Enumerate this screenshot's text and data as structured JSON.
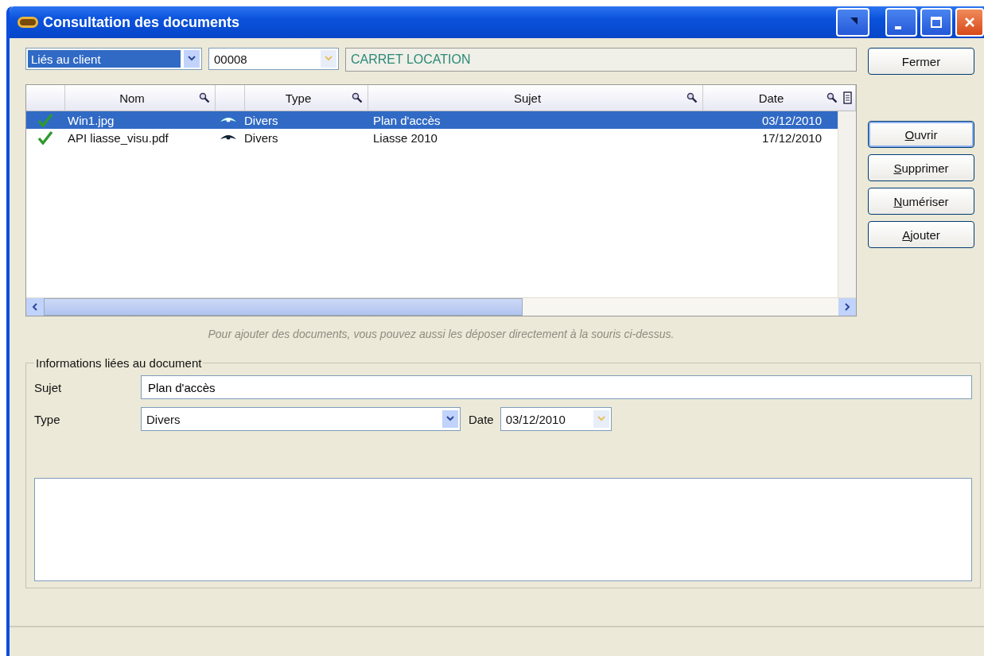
{
  "window": {
    "title": "Consultation des documents"
  },
  "filter": {
    "value": "Liés au client"
  },
  "client_code": {
    "value": "00008"
  },
  "client_name": {
    "value": "CARRET LOCATION"
  },
  "close_button": {
    "label": "Fermer"
  },
  "table": {
    "columns": [
      "Nom",
      "Type",
      "Sujet",
      "Date"
    ],
    "rows": [
      {
        "nom": "Win1.jpg",
        "type": "Divers",
        "sujet": "Plan d'accès",
        "date": "03/12/2010",
        "selected": true
      },
      {
        "nom": "API liasse_visu.pdf",
        "type": "Divers",
        "sujet": "Liasse 2010",
        "date": "17/12/2010",
        "selected": false
      }
    ]
  },
  "actions": [
    {
      "label": "Ouvrir",
      "focused": true
    },
    {
      "label": "Supprimer",
      "focused": false
    },
    {
      "label": "Numériser",
      "focused": false
    },
    {
      "label": "Ajouter",
      "focused": false
    }
  ],
  "hint": "Pour ajouter des documents, vous pouvez aussi les déposer directement à la souris ci-dessus.",
  "details": {
    "legend": "Informations liées au document",
    "subject_label": "Sujet",
    "subject": "Plan d'accès",
    "type_label": "Type",
    "type": "Divers",
    "date_label": "Date",
    "date": "03/12/2010"
  }
}
